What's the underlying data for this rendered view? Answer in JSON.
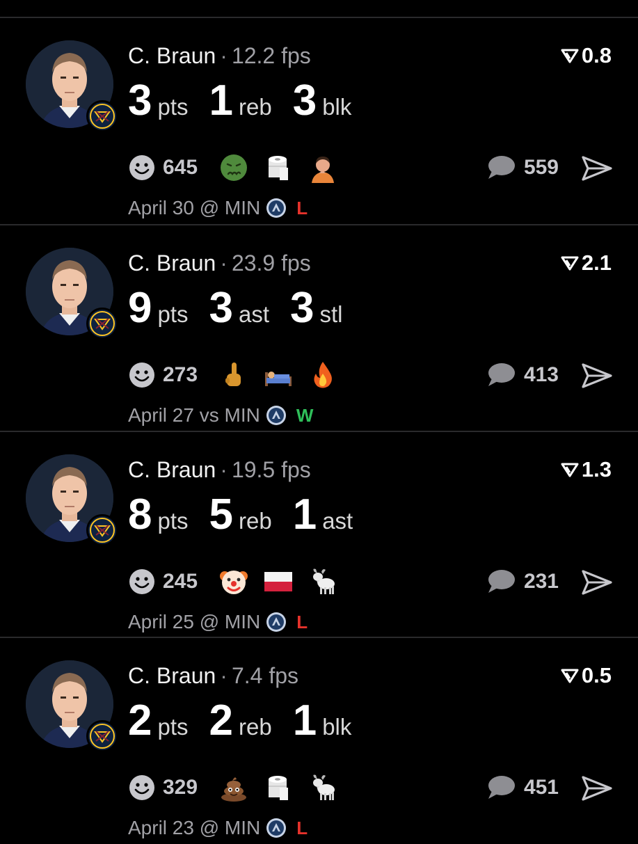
{
  "cards": [
    {
      "player": "C. Braun",
      "separator": "·",
      "fps": "12.2 fps",
      "score": "0.8",
      "stats": [
        {
          "value": "3",
          "label": "pts"
        },
        {
          "value": "1",
          "label": "reb"
        },
        {
          "value": "3",
          "label": "blk"
        }
      ],
      "reaction_count": "645",
      "emojis": [
        "nauseated-face-icon",
        "toilet-paper-icon",
        "person-hand-on-chin-icon"
      ],
      "comment_count": "559",
      "game": "April 30 @ MIN",
      "result": "L"
    },
    {
      "player": "C. Braun",
      "separator": "·",
      "fps": "23.9 fps",
      "score": "2.1",
      "stats": [
        {
          "value": "9",
          "label": "pts"
        },
        {
          "value": "3",
          "label": "ast"
        },
        {
          "value": "3",
          "label": "stl"
        }
      ],
      "reaction_count": "273",
      "emojis": [
        "middle-finger-icon",
        "person-in-bed-icon",
        "fire-icon"
      ],
      "comment_count": "413",
      "game": "April 27 vs MIN",
      "result": "W"
    },
    {
      "player": "C. Braun",
      "separator": "·",
      "fps": "19.5 fps",
      "score": "1.3",
      "stats": [
        {
          "value": "8",
          "label": "pts"
        },
        {
          "value": "5",
          "label": "reb"
        },
        {
          "value": "1",
          "label": "ast"
        }
      ],
      "reaction_count": "245",
      "emojis": [
        "clown-face-icon",
        "flag-poland-icon",
        "goat-icon"
      ],
      "comment_count": "231",
      "game": "April 25 @ MIN",
      "result": "L"
    },
    {
      "player": "C. Braun",
      "separator": "·",
      "fps": "7.4 fps",
      "score": "0.5",
      "stats": [
        {
          "value": "2",
          "label": "pts"
        },
        {
          "value": "2",
          "label": "reb"
        },
        {
          "value": "1",
          "label": "blk"
        }
      ],
      "reaction_count": "329",
      "emojis": [
        "pile-of-poo-icon",
        "toilet-paper-icon",
        "goat-icon"
      ],
      "comment_count": "451",
      "game": "April 23 @ MIN",
      "result": "L"
    }
  ],
  "colors": {
    "background": "#000000",
    "loss": "#e5322b",
    "win": "#2fbf5a",
    "muted_text": "#a1a1a6"
  }
}
